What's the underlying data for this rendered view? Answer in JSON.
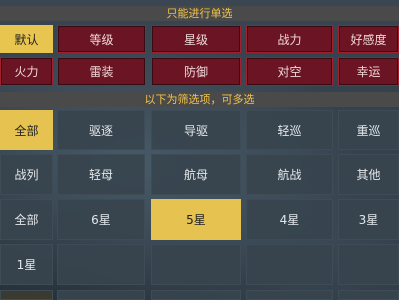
{
  "single_header": "只能进行单选",
  "multi_header": "以下为筛选项，可多选",
  "sort": {
    "row1": [
      "默认",
      "等级",
      "星级",
      "战力",
      "好感度"
    ],
    "row2": [
      "火力",
      "雷装",
      "防御",
      "对空",
      "幸运"
    ],
    "selected": "默认"
  },
  "filters": {
    "type_row1": [
      "全部",
      "驱逐",
      "导驱",
      "轻巡",
      "重巡"
    ],
    "type_row2": [
      "战列",
      "轻母",
      "航母",
      "航战",
      "其他"
    ],
    "star_row1": [
      "全部",
      "6星",
      "5星",
      "4星",
      "3星"
    ],
    "star_row2": [
      "1星"
    ],
    "selected_star": "5星"
  },
  "colors": {
    "accent_yellow": "#e7c54f",
    "sort_red": "#6b1424",
    "panel_dark": "#37444e"
  }
}
